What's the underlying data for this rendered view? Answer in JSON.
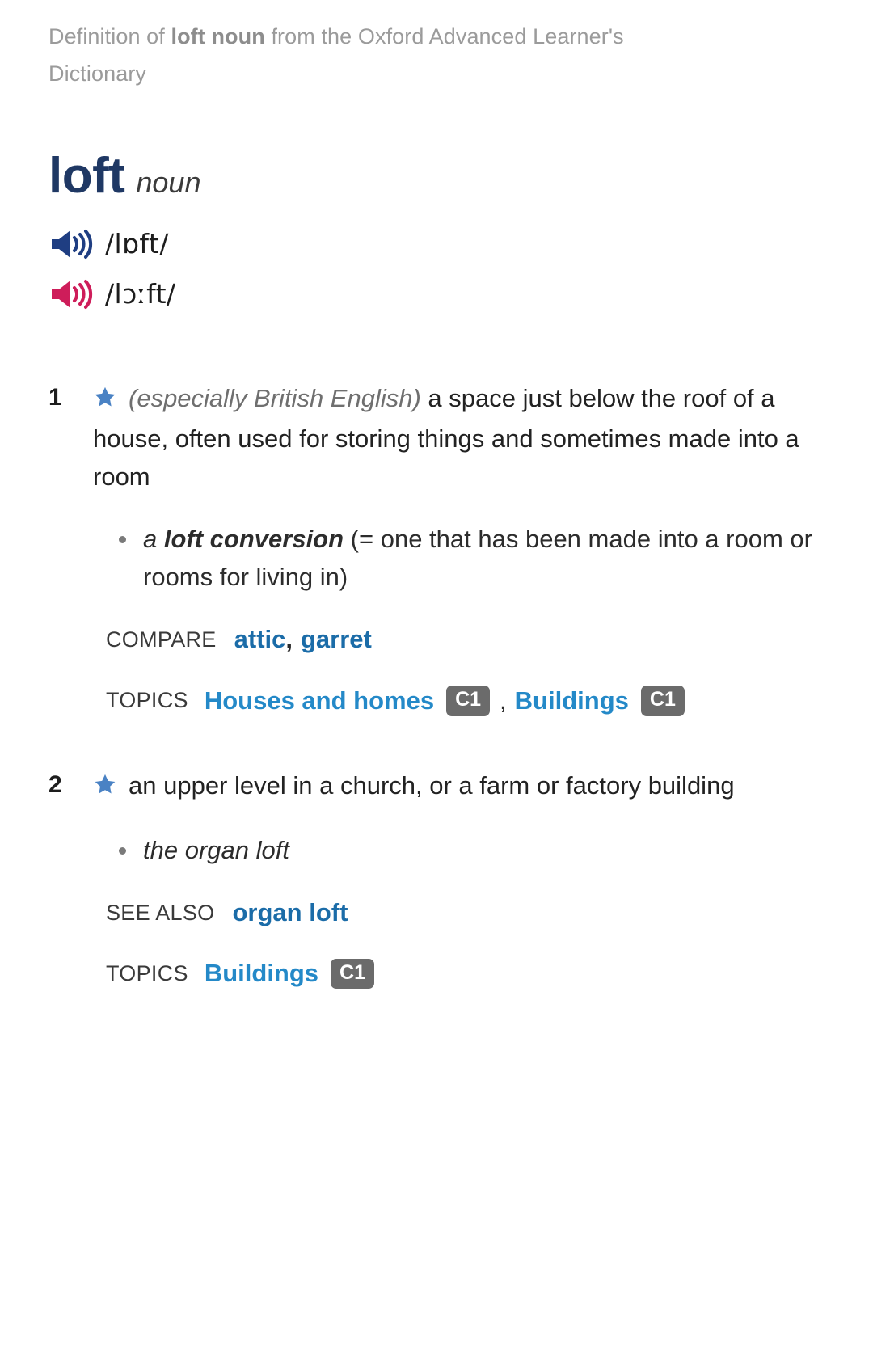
{
  "header": {
    "prefix": "Definition of ",
    "bold": "loft noun",
    "suffix": " from the Oxford Advanced Learner's Dictionary"
  },
  "entry": {
    "headword": "loft",
    "part_of_speech": "noun"
  },
  "pronunciations": [
    {
      "variety": "british",
      "icon": "speaker-icon",
      "color": "#1f3e82",
      "phonetic": "/lɒft/"
    },
    {
      "variety": "american",
      "icon": "speaker-icon",
      "color": "#ce1d5a",
      "phonetic": "/lɔːft/"
    }
  ],
  "senses": [
    {
      "number": "1",
      "star_icon": "star-icon",
      "star_color": "#4a82c4",
      "region": "(especially British English)",
      "definition": " a space just below the roof of a house, often used for storing things and sometimes made into a room",
      "examples": [
        {
          "lead": "a ",
          "bold": "loft conversion",
          "gloss": " (= one that has been made into a room or rooms for living in)"
        }
      ],
      "xref": {
        "label": "COMPARE",
        "links": [
          "attic",
          "garret"
        ],
        "separator": ","
      },
      "topics": {
        "label": "TOPICS",
        "items": [
          {
            "name": "Houses and homes",
            "cefr": "C1"
          },
          {
            "name": "Buildings",
            "cefr": "C1"
          }
        ],
        "separator": ","
      }
    },
    {
      "number": "2",
      "star_icon": "star-icon",
      "star_color": "#4a82c4",
      "region": "",
      "definition": "an upper level in a church, or a farm or factory building",
      "examples": [
        {
          "lead": "the organ loft",
          "bold": "",
          "gloss": ""
        }
      ],
      "xref": {
        "label": "SEE ALSO",
        "links": [
          "organ loft"
        ],
        "separator": ""
      },
      "topics": {
        "label": "TOPICS",
        "items": [
          {
            "name": "Buildings",
            "cefr": "C1"
          }
        ],
        "separator": ""
      }
    }
  ]
}
